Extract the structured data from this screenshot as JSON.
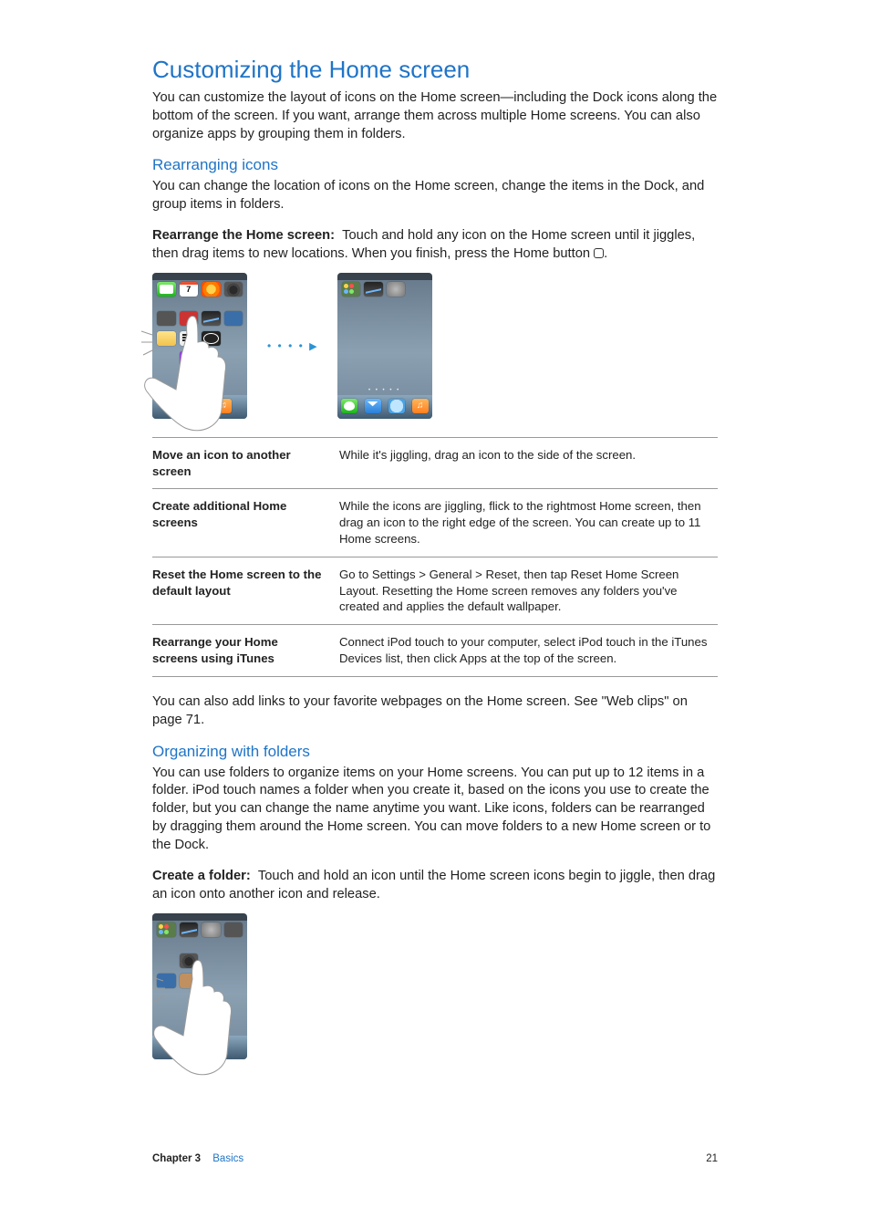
{
  "section_title": "Customizing the Home screen",
  "intro": "You can customize the layout of icons on the Home screen—including the Dock icons along the bottom of the screen. If you want, arrange them across multiple Home screens. You can also organize apps by grouping them in folders.",
  "sub1": {
    "heading": "Rearranging icons",
    "para": "You can change the location of icons on the Home screen, change the items in the Dock, and group items in folders.",
    "task_label": "Rearrange the Home screen:",
    "task_text_a": "Touch and hold any icon on the Home screen until it jiggles, then drag items to new locations. When you finish, press the Home button ",
    "task_text_b": "."
  },
  "table": {
    "rows": [
      {
        "term": "Move an icon to another screen",
        "desc": "While it's jiggling, drag an icon to the side of the screen."
      },
      {
        "term": "Create additional Home screens",
        "desc": "While the icons are jiggling, flick to the rightmost Home screen, then drag an icon to the right edge of the screen. You can create up to 11 Home screens."
      },
      {
        "term": "Reset the Home screen to the default layout",
        "desc": "Go to Settings > General > Reset, then tap Reset Home Screen Layout. Resetting the Home screen removes any folders you've created and applies the default wallpaper."
      },
      {
        "term": "Rearrange your Home screens using iTunes",
        "desc": "Connect iPod touch to your computer, select iPod touch in the iTunes Devices list, then click Apps at the top of the screen."
      }
    ]
  },
  "after_table": {
    "text_a": "You can also add links to your favorite webpages on the Home screen. See \"",
    "link": "Web clips",
    "text_b": "\" on page ",
    "page_ref": "71",
    "text_c": "."
  },
  "sub2": {
    "heading": "Organizing with folders",
    "para": "You can use folders to organize items on your Home screens. You can put up to 12 items in a folder. iPod touch names a folder when you create it, based on the icons you use to create the folder, but you can change the name anytime you want. Like icons, folders can be rearranged by dragging them around the Home screen. You can move folders to a new Home screen or to the Dock.",
    "task_label": "Create a folder:",
    "task_text": "Touch and hold an icon until the Home screen icons begin to jiggle, then drag an icon onto another icon and release."
  },
  "footer": {
    "chapter_label": "Chapter 3",
    "chapter_title": "Basics",
    "page_number": "21"
  }
}
